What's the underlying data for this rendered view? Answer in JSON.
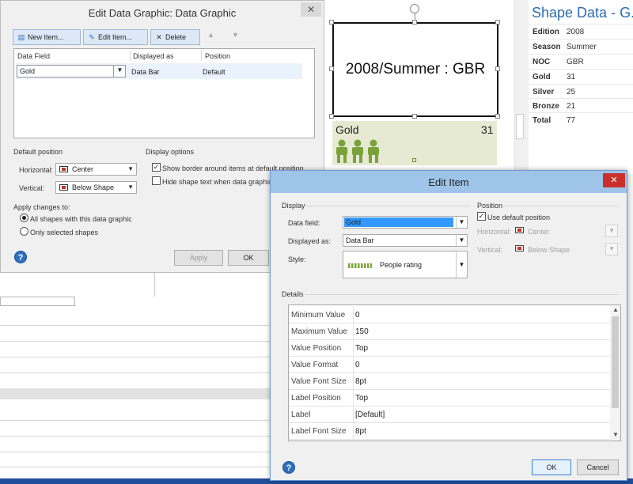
{
  "edit_data_graphic": {
    "title": "Edit Data Graphic: Data Graphic",
    "close": "✕",
    "toolbar": {
      "new_item": "New Item...",
      "edit_item": "Edit Item...",
      "delete": "Delete"
    },
    "columns": [
      "Data Field",
      "Displayed as",
      "Position"
    ],
    "item": {
      "field": "Gold",
      "displayed_as": "Data Bar",
      "position": "Default"
    },
    "default_position_label": "Default position",
    "horizontal_label": "Horizontal:",
    "horizontal_value": "Center",
    "vertical_label": "Vertical:",
    "vertical_value": "Below Shape",
    "display_options_label": "Display options",
    "show_border_label": "Show border around items at default position",
    "hide_text_label": "Hide shape text when data graphic",
    "apply_changes_label": "Apply changes to:",
    "all_shapes_label": "All shapes with this data graphic",
    "selected_shapes_label": "Only selected shapes",
    "apply_button": "Apply",
    "ok_button": "OK",
    "help": "?"
  },
  "shape": {
    "text": "2008/Summer : GBR",
    "databar_label": "Gold",
    "databar_value": "31"
  },
  "shape_data": {
    "title": "Shape Data - G...",
    "rows": [
      {
        "key": "Edition",
        "value": "2008"
      },
      {
        "key": "Season",
        "value": "Summer"
      },
      {
        "key": "NOC",
        "value": "GBR"
      },
      {
        "key": "Gold",
        "value": "31"
      },
      {
        "key": "Silver",
        "value": "25"
      },
      {
        "key": "Bronze",
        "value": "21"
      },
      {
        "key": "Total",
        "value": "77"
      }
    ]
  },
  "edit_item": {
    "title": "Edit Item",
    "close": "✕",
    "display_label": "Display",
    "data_field_label": "Data field:",
    "data_field_value": "Gold",
    "displayed_as_label": "Displayed as:",
    "displayed_as_value": "Data Bar",
    "style_label": "Style:",
    "style_value": "People rating",
    "position_label": "Position",
    "use_default_label": "Use default position",
    "horizontal_label": "Horizontal:",
    "horizontal_value": "Center",
    "vertical_label": "Vertical:",
    "vertical_value": "Below Shape",
    "details_label": "Details",
    "details": [
      {
        "key": "Minimum Value",
        "value": "0"
      },
      {
        "key": "Maximum Value",
        "value": "150"
      },
      {
        "key": "Value Position",
        "value": "Top"
      },
      {
        "key": "Value Format",
        "value": "0"
      },
      {
        "key": "Value Font Size",
        "value": "8pt"
      },
      {
        "key": "Label Position",
        "value": "Top"
      },
      {
        "key": "Label",
        "value": "[Default]"
      },
      {
        "key": "Label Font Size",
        "value": "8pt"
      }
    ],
    "ok_button": "OK",
    "cancel_button": "Cancel",
    "help": "?"
  }
}
